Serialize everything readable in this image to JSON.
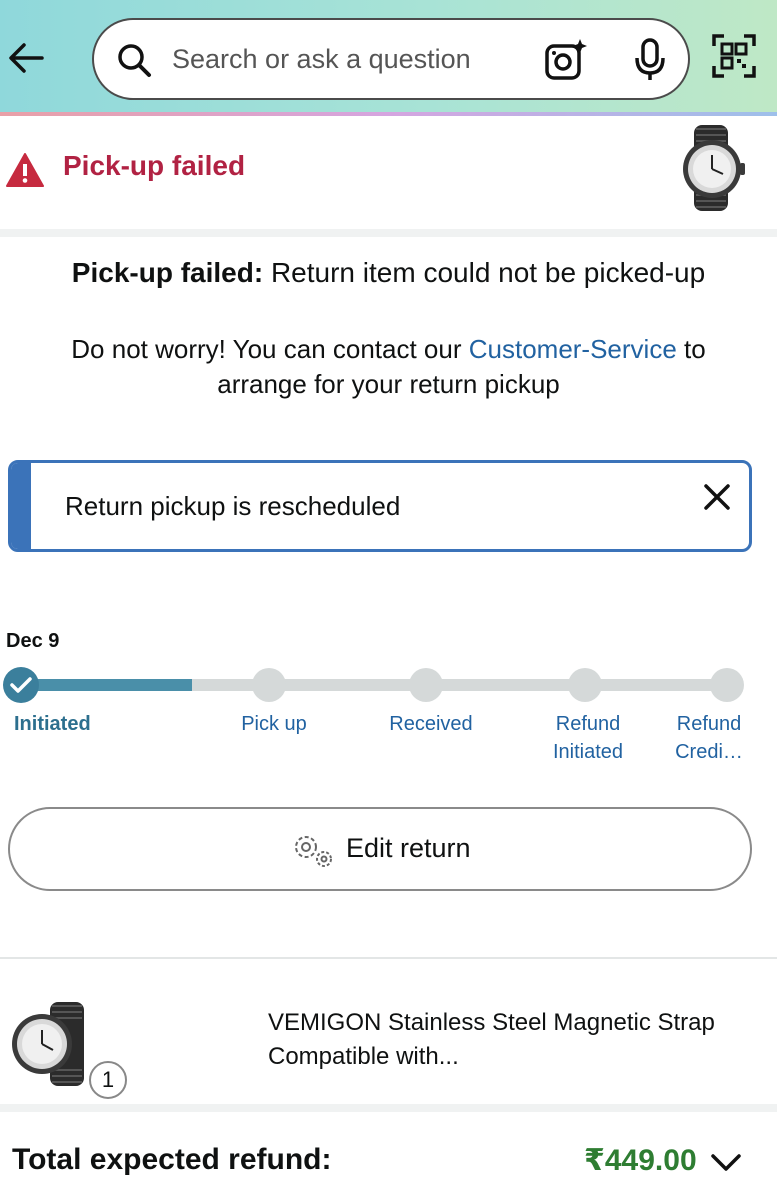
{
  "search": {
    "placeholder": "Search or ask a question"
  },
  "alert": {
    "title": "Pick-up failed"
  },
  "message": {
    "bold": "Pick-up failed:",
    "rest": " Return item could not be picked-up",
    "line2_before": "Do not worry! You can contact our ",
    "link": "Customer-Service",
    "line2_after": " to arrange for your return pickup"
  },
  "banner": {
    "text": "Return pickup is rescheduled"
  },
  "tracker": {
    "date": "Dec 9",
    "steps": [
      {
        "label": "Initiated",
        "state": "done"
      },
      {
        "label": "Pick up",
        "state": "pending"
      },
      {
        "label": "Received",
        "state": "pending"
      },
      {
        "label": "Refund Initiated",
        "state": "pending"
      },
      {
        "label": "Refund Credi…",
        "state": "pending"
      }
    ]
  },
  "edit": {
    "label": "Edit return"
  },
  "item": {
    "title": "VEMIGON Stainless Steel Magnetic Strap Compatible with...",
    "quantity": "1"
  },
  "total": {
    "label": "Total expected refund:",
    "value": "₹449.00"
  },
  "colors": {
    "alert_red": "#b12243",
    "link_blue": "#2162a1",
    "accent_teal": "#3b7f9c",
    "refund_green": "#2e7d32"
  }
}
